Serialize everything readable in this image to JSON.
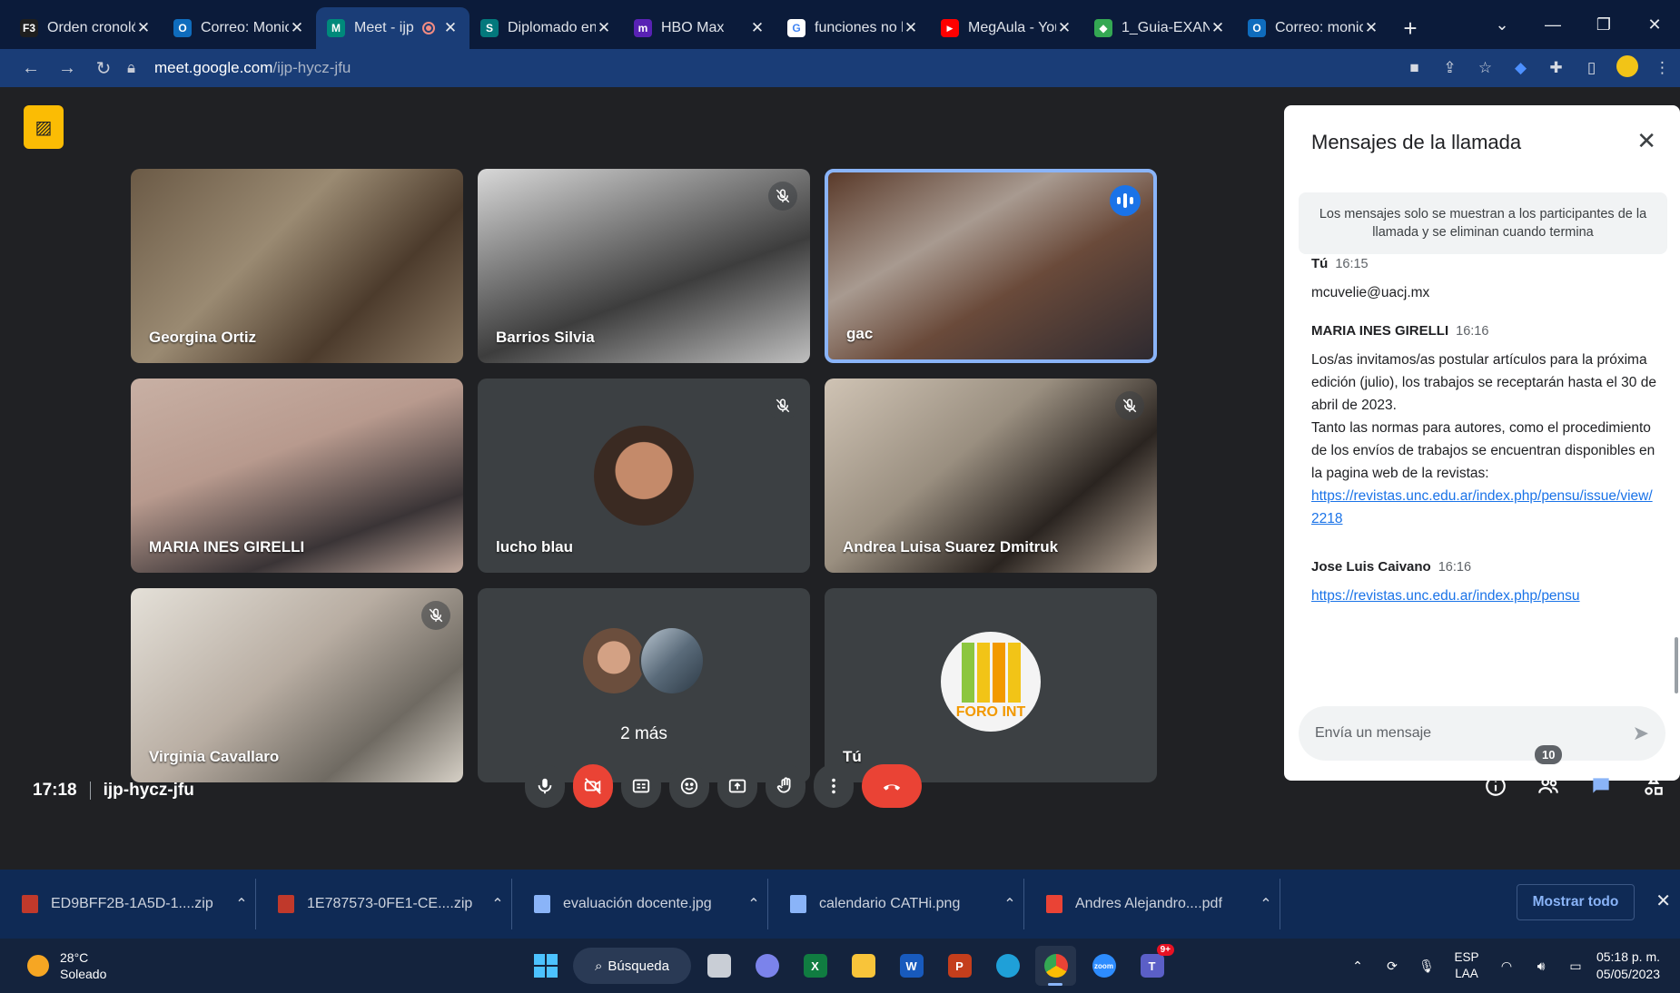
{
  "browser": {
    "tabs": [
      {
        "title": "Orden cronoló",
        "favicon": "F3",
        "color": "#1f1f1f"
      },
      {
        "title": "Correo: Monic",
        "favicon": "O",
        "color": "#0f6cbd"
      },
      {
        "title": "Meet - ijp",
        "favicon": "M",
        "color": "#00897b",
        "active": true
      },
      {
        "title": "Diplomado en",
        "favicon": "S",
        "color": "#03787c"
      },
      {
        "title": "HBO Max",
        "favicon": "m",
        "color": "#5822b4"
      },
      {
        "title": "funciones no l",
        "favicon": "G",
        "color": "#ffffff"
      },
      {
        "title": "MegAula - You",
        "favicon": "▶",
        "color": "#ff0000"
      },
      {
        "title": "1_Guia-EXANI",
        "favicon": "◆",
        "color": "#34a853"
      },
      {
        "title": "Correo: monic",
        "favicon": "O",
        "color": "#0f6cbd"
      }
    ],
    "url_host": "meet.google.com",
    "url_path": "/ijp-hycz-jfu"
  },
  "meet": {
    "participants": [
      {
        "name": "Georgina Ortiz",
        "muted": false
      },
      {
        "name": "Barrios Silvia",
        "muted": true
      },
      {
        "name": "gac",
        "muted": false,
        "speaking": true
      },
      {
        "name": "MARIA INES GIRELLI",
        "muted": false
      },
      {
        "name": "lucho blau",
        "muted": true
      },
      {
        "name": "Andrea Luisa Suarez Dmitruk",
        "muted": true
      },
      {
        "name": "Virginia Cavallaro",
        "muted": true
      },
      {
        "name": "2 más",
        "muted": false
      },
      {
        "name": "Tú",
        "muted": false
      }
    ],
    "foro_text": "FORO INT",
    "time": "17:18",
    "meeting_code": "ijp-hycz-jfu",
    "people_count": "10"
  },
  "chat": {
    "title": "Mensajes de la llamada",
    "note": "Los mensajes solo se muestran a los participantes de la llamada y se eliminan cuando termina",
    "messages": [
      {
        "sender": "Tú",
        "time": "16:15",
        "text": "mcuvelie@uacj.mx"
      },
      {
        "sender": "MARIA INES GIRELLI",
        "time": "16:16",
        "text": "Los/as invitamos/as postular artículos para la próxima edición (julio),  los trabajos se receptarán hasta el 30 de abril de 2023.\nTanto las  normas para autores, como el procedimiento de los envíos de trabajos se encuentran disponibles en la pagina web de la revistas:",
        "link": "https://revistas.unc.edu.ar/index.php/pensu/issue/view/2218"
      },
      {
        "sender": "Jose Luis Caivano",
        "time": "16:16",
        "link": "https://revistas.unc.edu.ar/index.php/pensu"
      }
    ],
    "input_placeholder": "Envía un mensaje"
  },
  "downloads": {
    "files": [
      {
        "name": "ED9BFF2B-1A5D-1....zip",
        "color": "#c0392b"
      },
      {
        "name": "1E787573-0FE1-CE....zip",
        "color": "#c0392b"
      },
      {
        "name": "evaluación docente.jpg",
        "color": "#8ab4f8"
      },
      {
        "name": "calendario CATHi.png",
        "color": "#8ab4f8"
      },
      {
        "name": "Andres Alejandro....pdf",
        "color": "#ea4335"
      }
    ],
    "show_all": "Mostrar todo"
  },
  "taskbar": {
    "temp": "28°C",
    "condition": "Soleado",
    "search_label": "Búsqueda",
    "lang_top": "ESP",
    "lang_bottom": "LAA",
    "clock_time": "05:18 p. m.",
    "clock_date": "05/05/2023",
    "teams_badge": "9+"
  }
}
